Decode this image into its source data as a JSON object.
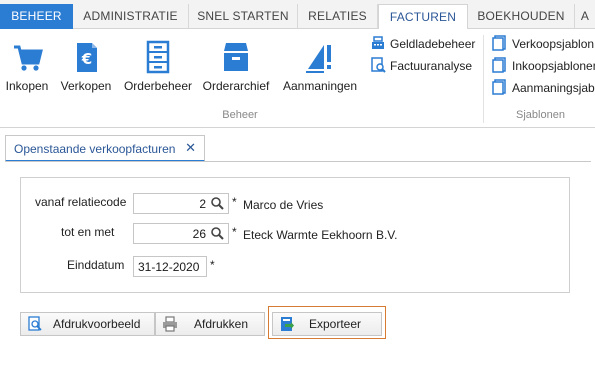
{
  "ribbon_tabs": [
    "BEHEER",
    "ADMINISTRATIE",
    "SNEL STARTEN",
    "RELATIES",
    "FACTUREN",
    "BOEKHOUDEN",
    "A"
  ],
  "ribbon": {
    "beheer_group": {
      "label": "Beheer",
      "buttons": [
        "Inkopen",
        "Verkopen",
        "Orderbeheer",
        "Orderarchief",
        "Aanmaningen"
      ],
      "small_buttons": [
        "Geldladebeheer",
        "Factuuranalyse"
      ]
    },
    "sjablonen_group": {
      "label": "Sjablonen",
      "small_buttons": [
        "Verkoopsjablon",
        "Inkoopsjablonen",
        "Aanmaningsjab"
      ]
    }
  },
  "doc_tab": {
    "title": "Openstaande verkoopfacturen",
    "close": "✕"
  },
  "form": {
    "vanaf": {
      "label": "vanaf relatiecode",
      "value": "2",
      "required": "*",
      "name": "Marco de Vries"
    },
    "totmet": {
      "label": "tot en met",
      "value": "26",
      "required": "*",
      "name": "Eteck Warmte Eekhoorn B.V."
    },
    "einddatum": {
      "label": "Einddatum",
      "value": "31-12-2020",
      "required": "*"
    }
  },
  "actions": {
    "preview": "Afdrukvoorbeeld",
    "print": "Afdrukken",
    "export": "Exporteer"
  },
  "colors": {
    "accent": "#2b7cd3",
    "focus_border": "#d77a32"
  }
}
